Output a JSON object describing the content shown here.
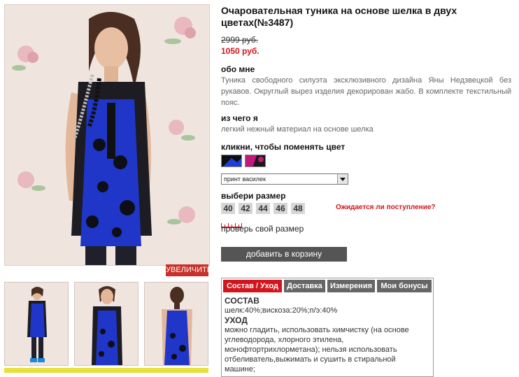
{
  "product": {
    "title": "Очаровательная туника на основе шелка в двух цветах(№3487)",
    "old_price": "2999 руб.",
    "new_price": "1050 руб."
  },
  "gallery": {
    "zoom_label": "УВЕЛИЧИТЬ",
    "thumbnails": [
      "thumb-front-full",
      "thumb-front",
      "thumb-back"
    ]
  },
  "about": {
    "heading": "обо мне",
    "text": "Туника свободного силуэта эксклюзивного дизайна Яны Недзвецкой без рукавов. Округлый вырез изделия декорирован жабо. В комплекте текстильный пояс."
  },
  "material": {
    "heading": "из чего я",
    "text": "легкий нежный материал на основе шелка"
  },
  "color": {
    "heading": "кликни, чтобы поменять цвет",
    "swatches": [
      {
        "name": "blue",
        "color": "#1e3fd8"
      },
      {
        "name": "pink",
        "color": "#c2187a"
      }
    ],
    "selected_option": "принт василек"
  },
  "size": {
    "heading": "выбери размер",
    "options": [
      "40",
      "42",
      "44",
      "46",
      "48"
    ],
    "waiting_link": "Ожидается ли поступление?",
    "check_link": "проверь свой размер"
  },
  "cart": {
    "add_label": "добавить в корзину"
  },
  "tabs": {
    "items": [
      "Состав / Уход",
      "Доставка",
      "Измерения",
      "Мои бонусы"
    ],
    "active_index": 0,
    "content": {
      "composition_heading": "СОСТАВ",
      "composition_text": "шелк:40%;вискоза:20%;п/э:40%",
      "care_heading": "УХОД",
      "care_text": "можно гладить, использовать химчистку (на основе углеводорода, хлорного этилена, монофтортрихлорметана); нельзя использовать отбеливатель,выжимать и сушить в стиральной машине;"
    }
  },
  "colors": {
    "accent_red": "#d4141c",
    "button_gray": "#555555",
    "tab_gray": "#666666"
  }
}
